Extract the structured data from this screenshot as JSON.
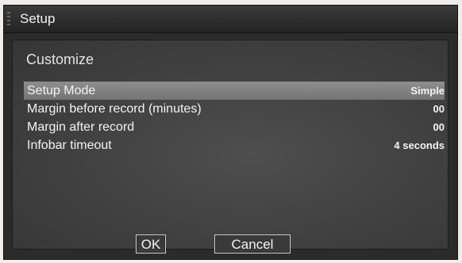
{
  "window": {
    "title": "Setup"
  },
  "panel": {
    "heading": "Customize",
    "rows": [
      {
        "label": "Setup Mode",
        "value": "Simple"
      },
      {
        "label": "Margin before record (minutes)",
        "value": "00"
      },
      {
        "label": "Margin after record",
        "value": "00"
      },
      {
        "label": "Infobar timeout",
        "value": "4 seconds"
      }
    ],
    "selected_row": 0
  },
  "buttons": {
    "ok": "OK",
    "cancel": "Cancel"
  },
  "colors": {
    "window_background": "#2b2b2b",
    "panel_background": "#404040",
    "selection_highlight": "#858585",
    "text": "#f4f4f4"
  }
}
